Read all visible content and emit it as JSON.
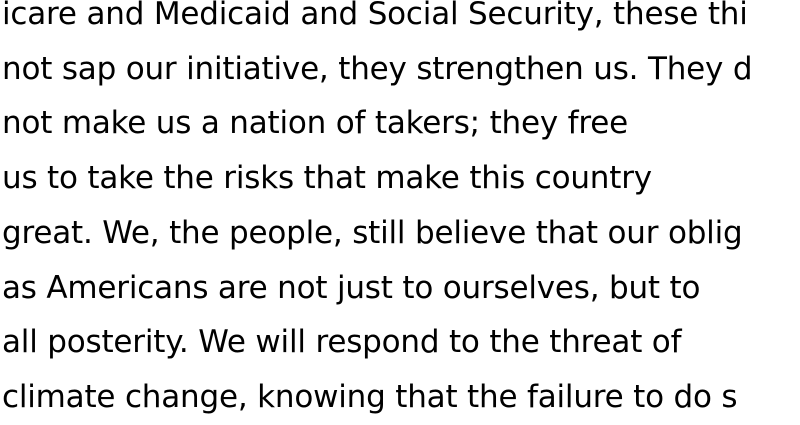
{
  "document": {
    "lines": [
      "icare and Medicaid and Social Security, these thi",
      "not sap our initiative, they strengthen us. They d",
      "not make us a nation of takers; they free",
      "us to take the risks that make this country",
      "great. We, the people, still believe that our oblig",
      "as Americans are not just to ourselves, but to",
      "all posterity. We will respond to the threat of",
      "climate change, knowing that the failure to do s"
    ]
  }
}
